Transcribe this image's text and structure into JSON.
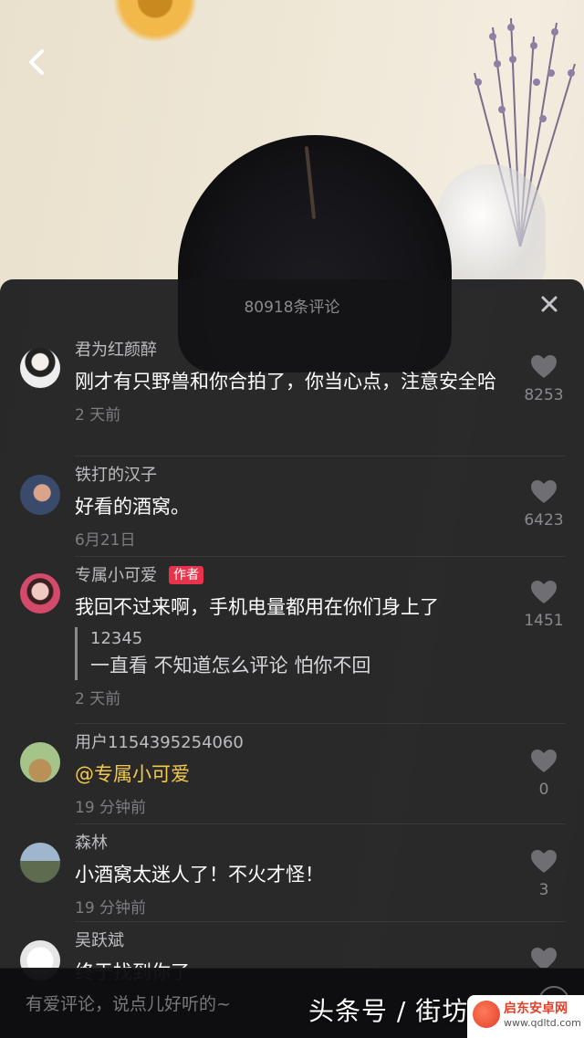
{
  "video": {
    "back_icon": "chevron-left-icon"
  },
  "panel": {
    "title": "80918条评论",
    "close_icon": "×"
  },
  "comments": [
    {
      "user": "君为红颜醉",
      "text": "刚才有只野兽和你合拍了，你当心点，注意安全哈",
      "time": "2 天前",
      "likes": "8253"
    },
    {
      "user": "铁打的汉子",
      "text": "好看的酒窝。",
      "time": "6月21日",
      "likes": "6423"
    },
    {
      "user": "专属小可爱",
      "badge": "作者",
      "text": "我回不过来啊，手机电量都用在你们身上了",
      "reply": {
        "user": "12345",
        "text": "一直看 不知道怎么评论 怕你不回"
      },
      "time": "2 天前",
      "likes": "1451"
    },
    {
      "user": "用户1154395254060",
      "text": "@专属小可爱",
      "time": "19 分钟前",
      "likes": "0"
    },
    {
      "user": "森林",
      "text": "小酒窝太迷人了！不火才怪！",
      "time": "19 分钟前",
      "likes": "3"
    },
    {
      "user": "吴跃斌",
      "text": "终于找到你了"
    }
  ],
  "input": {
    "placeholder": "有爱评论，说点儿好听的~"
  },
  "overlay": {
    "watermark": "头条号 / 街坊",
    "site_name": "启东安卓网",
    "site_url": "www.qdltd.com"
  },
  "colors": {
    "author_badge": "#e8334c",
    "mention": "#f2c94c"
  }
}
